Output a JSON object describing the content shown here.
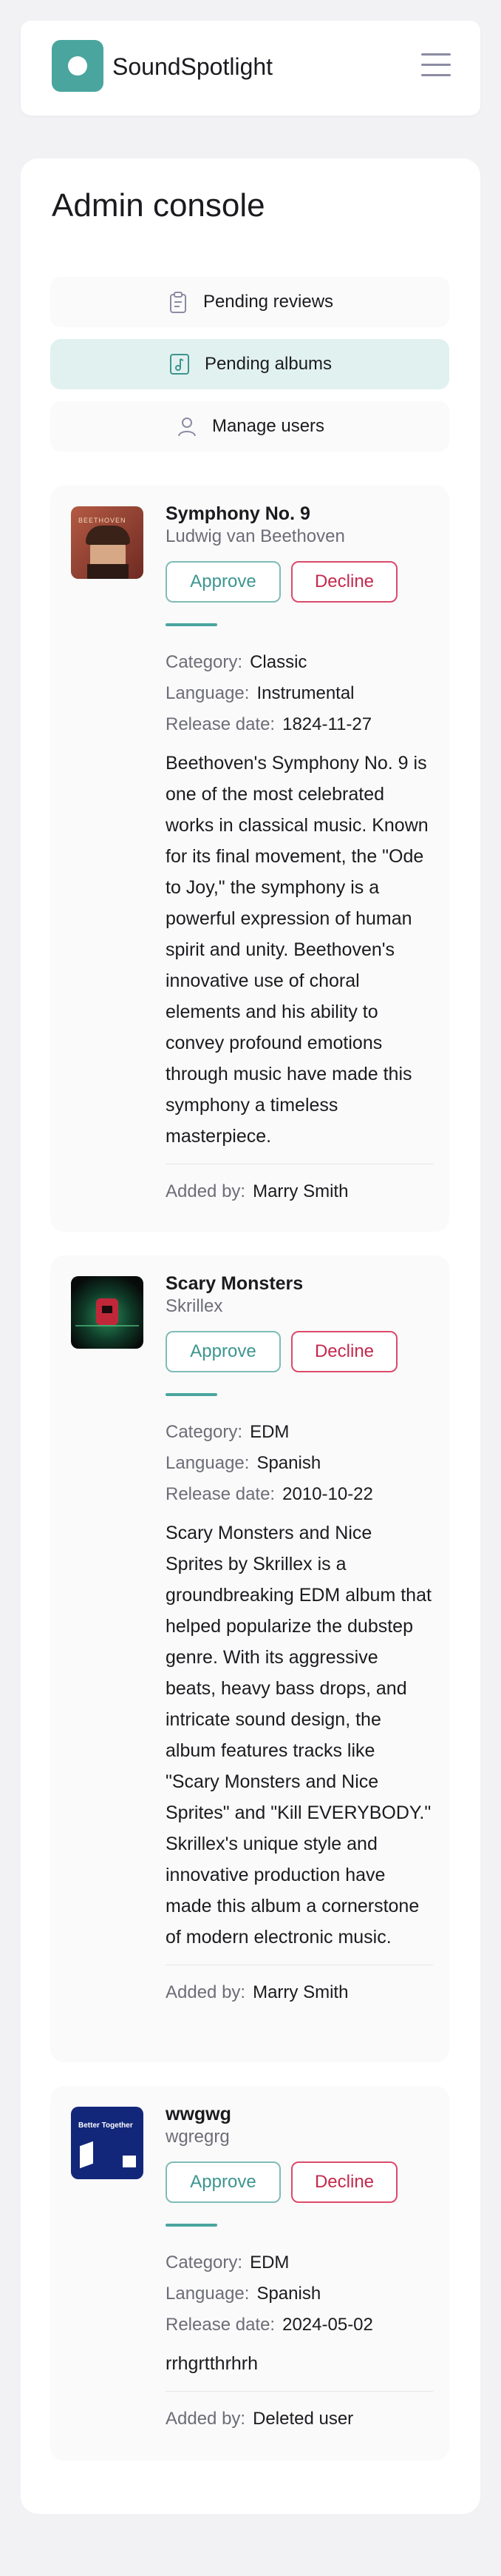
{
  "app": {
    "name": "SoundSpotlight"
  },
  "page": {
    "title": "Admin console"
  },
  "nav": [
    {
      "label": "Pending reviews",
      "icon": "clipboard-icon"
    },
    {
      "label": "Pending albums",
      "icon": "music-note-icon",
      "active": true
    },
    {
      "label": "Manage users",
      "icon": "user-icon"
    }
  ],
  "labels": {
    "approve": "Approve",
    "decline": "Decline",
    "category": "Category:",
    "language": "Language:",
    "release_date": "Release date:",
    "added_by": "Added by:"
  },
  "albums": [
    {
      "title": "Symphony No. 9",
      "artist": "Ludwig van Beethoven",
      "category": "Classic",
      "language": "Instrumental",
      "release_date": "1824-11-27",
      "description": "Beethoven's Symphony No. 9 is one of the most celebrated works in classical music. Known for its final movement, the \"Ode to Joy,\" the symphony is a powerful expression of human spirit and unity. Beethoven's innovative use of choral elements and his ability to convey profound emotions through music have made this symphony a timeless masterpiece.",
      "added_by": "Marry Smith",
      "cover_text": "BEETHOVEN"
    },
    {
      "title": "Scary Monsters",
      "artist": "Skrillex",
      "category": "EDM",
      "language": "Spanish",
      "release_date": "2010-10-22",
      "description": "Scary Monsters and Nice Sprites by Skrillex is a groundbreaking EDM album that helped popularize the dubstep genre. With its aggressive beats, heavy bass drops, and intricate sound design, the album features tracks like \"Scary Monsters and Nice Sprites\" and \"Kill EVERYBODY.\" Skrillex's unique style and innovative production have made this album a cornerstone of modern electronic music.",
      "added_by": "Marry Smith"
    },
    {
      "title": "wwgwg",
      "artist": "wgregrg",
      "category": "EDM",
      "language": "Spanish",
      "release_date": "2024-05-02",
      "description": "rrhgrtthrhrh",
      "added_by": "Deleted user",
      "cover_text": "Better Together"
    }
  ],
  "colors": {
    "accent": "#4aa59f",
    "decline": "#c5284d",
    "active_nav": "#e1f1f0"
  }
}
